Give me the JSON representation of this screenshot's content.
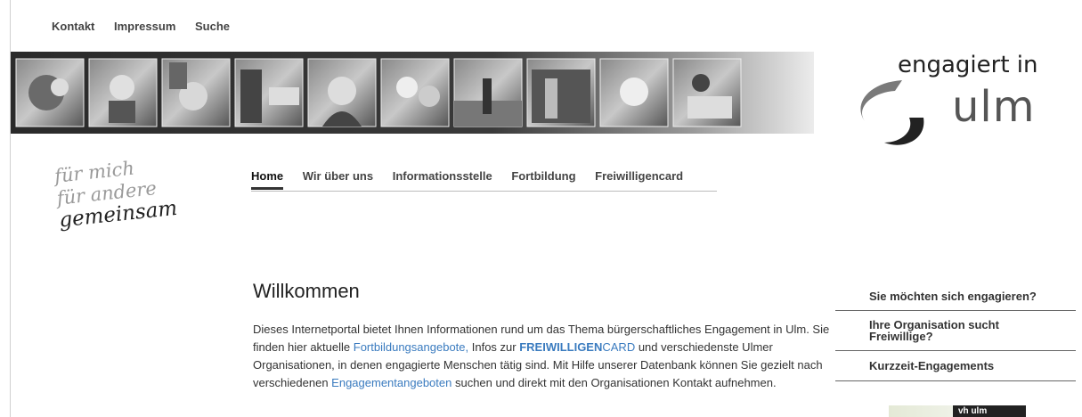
{
  "top_nav": {
    "items": [
      "Kontakt",
      "Impressum",
      "Suche"
    ]
  },
  "logo": {
    "line1": "engagiert in",
    "line2": "ulm"
  },
  "slogan": {
    "line1": "für mich",
    "line2": "für andere",
    "line3": "gemeinsam"
  },
  "main_nav": {
    "items": [
      "Home",
      "Wir über uns",
      "Informationsstelle",
      "Fortbildung",
      "Freiwilligencard"
    ],
    "active": "Home"
  },
  "content": {
    "title": "Willkommen",
    "p1": "Dieses Internetportal bietet Ihnen Informationen rund um das Thema bürgerschaftliches Engagement in Ulm. Sie finden hier aktuelle ",
    "link_fortbildung": "Fortbildungsangebote,",
    "p2": " Infos zur ",
    "fwc_bold": "FREIWILLIGEN",
    "fwc_normal": "CARD",
    "p3": " und verschiedenste Ulmer Organisationen, in denen engagierte Menschen tätig sind. Mit Hilfe unserer Datenbank können Sie gezielt nach verschiedenen ",
    "link_engagement": "Engagementangeboten",
    "p4": " suchen und direkt mit den Organisationen Kontakt aufnehmen."
  },
  "sidebar": {
    "items": [
      "Sie möchten sich engagieren?",
      "Ihre Organisation sucht Freiwillige?",
      "Kurzzeit-Engagements"
    ]
  },
  "vh_ad": {
    "label": "vh ulm"
  },
  "colors": {
    "link": "#3a7bbf",
    "text": "#333333"
  }
}
